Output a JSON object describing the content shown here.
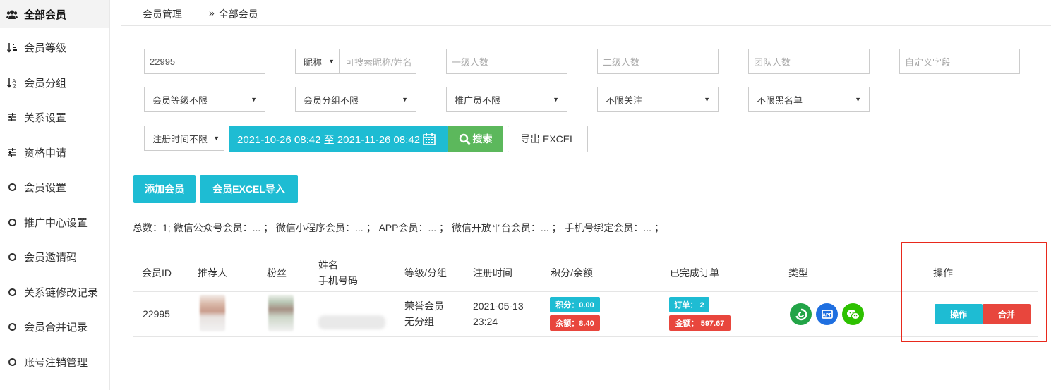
{
  "sidebar": {
    "items": [
      {
        "label": "全部会员",
        "icon": "users-icon"
      },
      {
        "label": "会员等级",
        "icon": "sort-numeric-icon"
      },
      {
        "label": "会员分组",
        "icon": "sort-alpha-icon"
      },
      {
        "label": "关系设置",
        "icon": "sliders-icon"
      },
      {
        "label": "资格申请",
        "icon": "sliders-icon"
      },
      {
        "label": "会员设置",
        "icon": "circle-icon"
      },
      {
        "label": "推广中心设置",
        "icon": "circle-icon"
      },
      {
        "label": "会员邀请码",
        "icon": "circle-icon"
      },
      {
        "label": "关系链修改记录",
        "icon": "circle-icon"
      },
      {
        "label": "会员合并记录",
        "icon": "circle-icon"
      },
      {
        "label": "账号注销管理",
        "icon": "circle-icon"
      }
    ]
  },
  "breadcrumb": {
    "parent": "会员管理",
    "separator": "»",
    "current": "全部会员"
  },
  "filters": {
    "member_id_value": "22995",
    "nickname_select": "昵称",
    "nickname_placeholder": "可搜索昵称/姓名",
    "level1_placeholder": "一级人数",
    "level2_placeholder": "二级人数",
    "team_placeholder": "团队人数",
    "custom_placeholder": "自定义字段",
    "level_select": "会员等级不限",
    "group_select": "会员分组不限",
    "promoter_select": "推广员不限",
    "follow_select": "不限关注",
    "blacklist_select": "不限黑名单",
    "regtime_select": "注册时间不限",
    "date_range": "2021-10-26 08:42 至 2021-11-26 08:42",
    "search_label": "搜索",
    "export_label": "导出 EXCEL"
  },
  "actions": {
    "add_member": "添加会员",
    "import_excel": "会员EXCEL导入"
  },
  "summary": "总数：1; 微信公众号会员：... ； 微信小程序会员：... ； APP会员：... ； 微信开放平台会员：... ； 手机号绑定会员：... ；",
  "table": {
    "headers": {
      "id": "会员ID",
      "referrer": "推荐人",
      "fans": "粉丝",
      "name": "姓名",
      "phone": "手机号码",
      "level": "等级/分组",
      "regtime": "注册时间",
      "points": "积分/余额",
      "orders": "已完成订单",
      "type": "类型",
      "ops": "操作"
    },
    "rows": [
      {
        "id": "22995",
        "level": "荣誉会员",
        "group": "无分组",
        "reg_date": "2021-05-13",
        "reg_time": "23:24",
        "points": "积分：0.00",
        "balance": "余额：8.40",
        "orders": "订单： 2",
        "amount": "金额： 597.67",
        "types": [
          "green-swirl-icon",
          "blue-app-icon",
          "wechat-icon"
        ],
        "op_label": "操作",
        "merge_label": "合并"
      }
    ]
  },
  "colors": {
    "teal": "#1ebcd3",
    "green": "#5cb85c",
    "red": "#e8463d",
    "highlight": "#e8291c"
  }
}
